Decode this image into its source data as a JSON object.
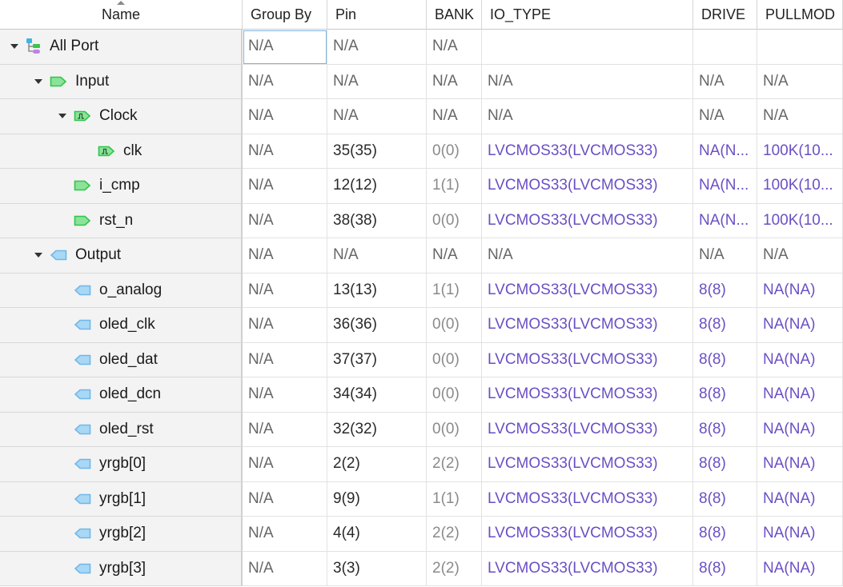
{
  "columns": [
    "Name",
    "Group By",
    "Pin",
    "BANK",
    "IO_TYPE",
    "DRIVE",
    "PULLMOD"
  ],
  "rows": [
    {
      "name": "All Port",
      "level": 0,
      "expand": true,
      "icon": "all-port-icon",
      "group": "N/A",
      "pin": "N/A",
      "bank": "N/A",
      "io_type": "",
      "drive": "",
      "pullmode": "",
      "kind": "group",
      "selected": true
    },
    {
      "name": "Input",
      "level": 1,
      "expand": true,
      "icon": "input-port-icon",
      "group": "N/A",
      "pin": "N/A",
      "bank": "N/A",
      "io_type": "N/A",
      "drive": "N/A",
      "pullmode": "N/A",
      "kind": "group"
    },
    {
      "name": "Clock",
      "level": 2,
      "expand": true,
      "icon": "clock-port-icon",
      "group": "N/A",
      "pin": "N/A",
      "bank": "N/A",
      "io_type": "N/A",
      "drive": "N/A",
      "pullmode": "N/A",
      "kind": "group"
    },
    {
      "name": "clk",
      "level": 3,
      "expand": false,
      "icon": "clock-port-icon",
      "group": "N/A",
      "pin": "35(35)",
      "bank": "0(0)",
      "io_type": "LVCMOS33(LVCMOS33)",
      "drive": "NA(N...",
      "pullmode": "100K(10...",
      "kind": "port"
    },
    {
      "name": "i_cmp",
      "level": 2,
      "expand": false,
      "icon": "input-port-icon",
      "group": "N/A",
      "pin": "12(12)",
      "bank": "1(1)",
      "io_type": "LVCMOS33(LVCMOS33)",
      "drive": "NA(N...",
      "pullmode": "100K(10...",
      "kind": "port"
    },
    {
      "name": "rst_n",
      "level": 2,
      "expand": false,
      "icon": "input-port-icon",
      "group": "N/A",
      "pin": "38(38)",
      "bank": "0(0)",
      "io_type": "LVCMOS33(LVCMOS33)",
      "drive": "NA(N...",
      "pullmode": "100K(10...",
      "kind": "port"
    },
    {
      "name": "Output",
      "level": 1,
      "expand": true,
      "icon": "output-port-icon",
      "group": "N/A",
      "pin": "N/A",
      "bank": "N/A",
      "io_type": "N/A",
      "drive": "N/A",
      "pullmode": "N/A",
      "kind": "group"
    },
    {
      "name": "o_analog",
      "level": 2,
      "expand": false,
      "icon": "output-port-icon",
      "group": "N/A",
      "pin": "13(13)",
      "bank": "1(1)",
      "io_type": "LVCMOS33(LVCMOS33)",
      "drive": "8(8)",
      "pullmode": "NA(NA)",
      "kind": "port"
    },
    {
      "name": "oled_clk",
      "level": 2,
      "expand": false,
      "icon": "output-port-icon",
      "group": "N/A",
      "pin": "36(36)",
      "bank": "0(0)",
      "io_type": "LVCMOS33(LVCMOS33)",
      "drive": "8(8)",
      "pullmode": "NA(NA)",
      "kind": "port"
    },
    {
      "name": "oled_dat",
      "level": 2,
      "expand": false,
      "icon": "output-port-icon",
      "group": "N/A",
      "pin": "37(37)",
      "bank": "0(0)",
      "io_type": "LVCMOS33(LVCMOS33)",
      "drive": "8(8)",
      "pullmode": "NA(NA)",
      "kind": "port"
    },
    {
      "name": "oled_dcn",
      "level": 2,
      "expand": false,
      "icon": "output-port-icon",
      "group": "N/A",
      "pin": "34(34)",
      "bank": "0(0)",
      "io_type": "LVCMOS33(LVCMOS33)",
      "drive": "8(8)",
      "pullmode": "NA(NA)",
      "kind": "port"
    },
    {
      "name": "oled_rst",
      "level": 2,
      "expand": false,
      "icon": "output-port-icon",
      "group": "N/A",
      "pin": "32(32)",
      "bank": "0(0)",
      "io_type": "LVCMOS33(LVCMOS33)",
      "drive": "8(8)",
      "pullmode": "NA(NA)",
      "kind": "port"
    },
    {
      "name": "yrgb[0]",
      "level": 2,
      "expand": false,
      "icon": "output-port-icon",
      "group": "N/A",
      "pin": "2(2)",
      "bank": "2(2)",
      "io_type": "LVCMOS33(LVCMOS33)",
      "drive": "8(8)",
      "pullmode": "NA(NA)",
      "kind": "port"
    },
    {
      "name": "yrgb[1]",
      "level": 2,
      "expand": false,
      "icon": "output-port-icon",
      "group": "N/A",
      "pin": "9(9)",
      "bank": "1(1)",
      "io_type": "LVCMOS33(LVCMOS33)",
      "drive": "8(8)",
      "pullmode": "NA(NA)",
      "kind": "port"
    },
    {
      "name": "yrgb[2]",
      "level": 2,
      "expand": false,
      "icon": "output-port-icon",
      "group": "N/A",
      "pin": "4(4)",
      "bank": "2(2)",
      "io_type": "LVCMOS33(LVCMOS33)",
      "drive": "8(8)",
      "pullmode": "NA(NA)",
      "kind": "port"
    },
    {
      "name": "yrgb[3]",
      "level": 2,
      "expand": false,
      "icon": "output-port-icon",
      "group": "N/A",
      "pin": "3(3)",
      "bank": "2(2)",
      "io_type": "LVCMOS33(LVCMOS33)",
      "drive": "8(8)",
      "pullmode": "NA(NA)",
      "kind": "port"
    }
  ],
  "colors": {
    "value_purple": "#6b4fc4",
    "input_green": "#2fc54a",
    "output_blue": "#6fb7ea",
    "name_column_bg": "#f3f3f3"
  }
}
